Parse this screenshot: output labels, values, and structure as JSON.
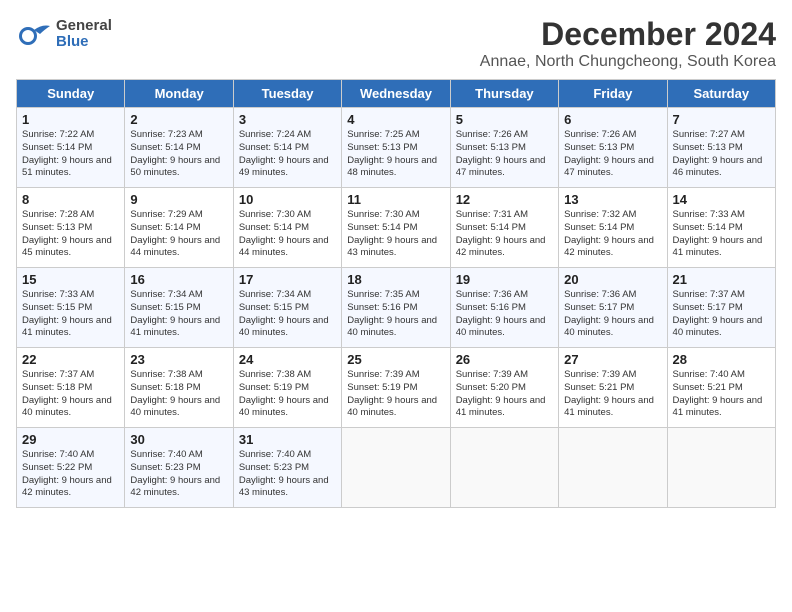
{
  "logo": {
    "line1": "General",
    "line2": "Blue"
  },
  "title": "December 2024",
  "subtitle": "Annae, North Chungcheong, South Korea",
  "weekdays": [
    "Sunday",
    "Monday",
    "Tuesday",
    "Wednesday",
    "Thursday",
    "Friday",
    "Saturday"
  ],
  "weeks": [
    [
      {
        "day": "1",
        "info": "Sunrise: 7:22 AM\nSunset: 5:14 PM\nDaylight: 9 hours and 51 minutes."
      },
      {
        "day": "2",
        "info": "Sunrise: 7:23 AM\nSunset: 5:14 PM\nDaylight: 9 hours and 50 minutes."
      },
      {
        "day": "3",
        "info": "Sunrise: 7:24 AM\nSunset: 5:14 PM\nDaylight: 9 hours and 49 minutes."
      },
      {
        "day": "4",
        "info": "Sunrise: 7:25 AM\nSunset: 5:13 PM\nDaylight: 9 hours and 48 minutes."
      },
      {
        "day": "5",
        "info": "Sunrise: 7:26 AM\nSunset: 5:13 PM\nDaylight: 9 hours and 47 minutes."
      },
      {
        "day": "6",
        "info": "Sunrise: 7:26 AM\nSunset: 5:13 PM\nDaylight: 9 hours and 47 minutes."
      },
      {
        "day": "7",
        "info": "Sunrise: 7:27 AM\nSunset: 5:13 PM\nDaylight: 9 hours and 46 minutes."
      }
    ],
    [
      {
        "day": "8",
        "info": "Sunrise: 7:28 AM\nSunset: 5:13 PM\nDaylight: 9 hours and 45 minutes."
      },
      {
        "day": "9",
        "info": "Sunrise: 7:29 AM\nSunset: 5:14 PM\nDaylight: 9 hours and 44 minutes."
      },
      {
        "day": "10",
        "info": "Sunrise: 7:30 AM\nSunset: 5:14 PM\nDaylight: 9 hours and 44 minutes."
      },
      {
        "day": "11",
        "info": "Sunrise: 7:30 AM\nSunset: 5:14 PM\nDaylight: 9 hours and 43 minutes."
      },
      {
        "day": "12",
        "info": "Sunrise: 7:31 AM\nSunset: 5:14 PM\nDaylight: 9 hours and 42 minutes."
      },
      {
        "day": "13",
        "info": "Sunrise: 7:32 AM\nSunset: 5:14 PM\nDaylight: 9 hours and 42 minutes."
      },
      {
        "day": "14",
        "info": "Sunrise: 7:33 AM\nSunset: 5:14 PM\nDaylight: 9 hours and 41 minutes."
      }
    ],
    [
      {
        "day": "15",
        "info": "Sunrise: 7:33 AM\nSunset: 5:15 PM\nDaylight: 9 hours and 41 minutes."
      },
      {
        "day": "16",
        "info": "Sunrise: 7:34 AM\nSunset: 5:15 PM\nDaylight: 9 hours and 41 minutes."
      },
      {
        "day": "17",
        "info": "Sunrise: 7:34 AM\nSunset: 5:15 PM\nDaylight: 9 hours and 40 minutes."
      },
      {
        "day": "18",
        "info": "Sunrise: 7:35 AM\nSunset: 5:16 PM\nDaylight: 9 hours and 40 minutes."
      },
      {
        "day": "19",
        "info": "Sunrise: 7:36 AM\nSunset: 5:16 PM\nDaylight: 9 hours and 40 minutes."
      },
      {
        "day": "20",
        "info": "Sunrise: 7:36 AM\nSunset: 5:17 PM\nDaylight: 9 hours and 40 minutes."
      },
      {
        "day": "21",
        "info": "Sunrise: 7:37 AM\nSunset: 5:17 PM\nDaylight: 9 hours and 40 minutes."
      }
    ],
    [
      {
        "day": "22",
        "info": "Sunrise: 7:37 AM\nSunset: 5:18 PM\nDaylight: 9 hours and 40 minutes."
      },
      {
        "day": "23",
        "info": "Sunrise: 7:38 AM\nSunset: 5:18 PM\nDaylight: 9 hours and 40 minutes."
      },
      {
        "day": "24",
        "info": "Sunrise: 7:38 AM\nSunset: 5:19 PM\nDaylight: 9 hours and 40 minutes."
      },
      {
        "day": "25",
        "info": "Sunrise: 7:39 AM\nSunset: 5:19 PM\nDaylight: 9 hours and 40 minutes."
      },
      {
        "day": "26",
        "info": "Sunrise: 7:39 AM\nSunset: 5:20 PM\nDaylight: 9 hours and 41 minutes."
      },
      {
        "day": "27",
        "info": "Sunrise: 7:39 AM\nSunset: 5:21 PM\nDaylight: 9 hours and 41 minutes."
      },
      {
        "day": "28",
        "info": "Sunrise: 7:40 AM\nSunset: 5:21 PM\nDaylight: 9 hours and 41 minutes."
      }
    ],
    [
      {
        "day": "29",
        "info": "Sunrise: 7:40 AM\nSunset: 5:22 PM\nDaylight: 9 hours and 42 minutes."
      },
      {
        "day": "30",
        "info": "Sunrise: 7:40 AM\nSunset: 5:23 PM\nDaylight: 9 hours and 42 minutes."
      },
      {
        "day": "31",
        "info": "Sunrise: 7:40 AM\nSunset: 5:23 PM\nDaylight: 9 hours and 43 minutes."
      },
      null,
      null,
      null,
      null
    ]
  ]
}
